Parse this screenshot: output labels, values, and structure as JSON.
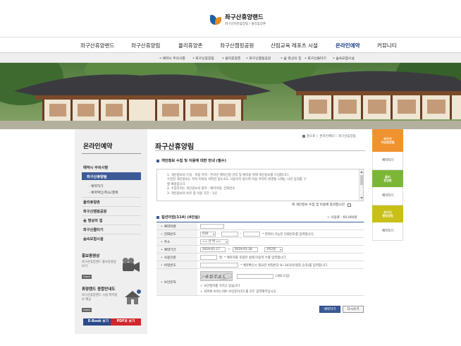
{
  "header": {
    "logo_title": "좌구산휴양랜드",
    "logo_subtitle": "좌구산자연휴양림 / 율리휴양촌"
  },
  "gnb": [
    {
      "label": "좌구산휴양랜드",
      "active": false
    },
    {
      "label": "좌구산휴양림",
      "active": false
    },
    {
      "label": "율리휴양촌",
      "active": false
    },
    {
      "label": "좌구산캠핑공원",
      "active": false
    },
    {
      "label": "산림교육 레포츠 시설",
      "active": false
    },
    {
      "label": "온라인예약",
      "active": true
    },
    {
      "label": "커뮤니티",
      "active": false
    }
  ],
  "subnav": [
    "• 예약시 주의사항",
    "• 좌구산휴양림",
    "• 율리휴양촌",
    "• 좌구산캠핑공원",
    "• 숲 명상의 집",
    "• 좌구산줄타기",
    "• 숲속모험시설"
  ],
  "sidebar": {
    "title": "온라인예약",
    "items": [
      "예약시 주의사항",
      "좌구산휴양림",
      "율리휴양촌",
      "좌구산캠핑공원",
      "숲 명상의 집",
      "좌구산줄타기",
      "숲속모험시설"
    ],
    "subitems": [
      "· 예약하기",
      "· 예약확인/취소/결제"
    ],
    "promo1": {
      "title": "홍보동영상",
      "desc": "좌구산휴양랜드 홍보동영상 보기",
      "more": "more"
    },
    "promo2": {
      "title": "휴양랜드 종합안내도",
      "desc": "좌구산휴양랜드 시설 위치정보 제공",
      "more": "more"
    },
    "ebook": "E-Book 보기",
    "pdf": "PDF로 보기"
  },
  "content": {
    "breadcrumb": "홈으로 〉온라인예약 〉좌구산휴양림",
    "page_title": "좌구산휴양림",
    "privacy_title": "개인정보 수집 및 이용에 대한 안내 (필수)",
    "privacy_lines": [
      "1. 개인정보의 수집 · 이용 목적 : 온라인 예약신청 관리 및 예약을 위해 개인정보를 수집합니다.",
      "   수집된 개인정보는 목적 이외의 어떠한 용도로도 사용하지 않으며 이용 목적이 변경될 시에는 사전 동의를 구",
      "   할 예정입니다.",
      "2. 수집하려는 개인정보의 항목 : 예약자명, 전화번호",
      "3. 개인정보의 보유 및 이용 기간 : 1년"
    ],
    "agree_label": "위 개인정보 수집 및 이용에 동의합니다.",
    "form_title": "집선이엄(114) (4인실)",
    "fee": "+ 사용료 : 60,000원",
    "rows": {
      "name": {
        "label": "예약자명"
      },
      "phone": {
        "label": "전화번호",
        "prefix": "010",
        "note": "* 연락이 가능한 전화번호를 입력합니다."
      },
      "address": {
        "label": "주소",
        "select": "== 선 택 =="
      },
      "period": {
        "label": "예약기간",
        "start": "2019-01-17",
        "tilde": "~",
        "end": "2019-01-18",
        "nights": "1박2일"
      },
      "people": {
        "label": "사용인원",
        "unit": "명",
        "note": "* 예약자를 포함한 실제 이용객 수를 입력합니다."
      },
      "password": {
        "label": "비밀번호",
        "note": "* 예약확인시 필요한 비밀번호 8~10자리(영문,숫자)를 입력합니다."
      },
      "captcha": {
        "label": "보안문자",
        "image_text": "40TAL",
        "refresh": "[새로고침]",
        "note1": "+ 보안절차를 거치고 있습니다.",
        "note2": "+ 좌측에 보이는대로 보안문자코드를 모두 입력해주십시오."
      }
    },
    "submit": "예약하기",
    "reset": "다시쓰기"
  },
  "rside": [
    {
      "tab": "좌구산\n자연휴양림",
      "color": "#f0922e",
      "sub": "예약하기"
    },
    {
      "tab": "율리\n휴양촌",
      "color": "#7cb637",
      "sub": "예약하기"
    },
    {
      "tab": "좌구산\n캠핑공원",
      "color": "#c8c018",
      "sub": "예약하기"
    }
  ],
  "colors": {
    "accent": "#3c5a96",
    "sidebar_bg": "#efefef"
  }
}
